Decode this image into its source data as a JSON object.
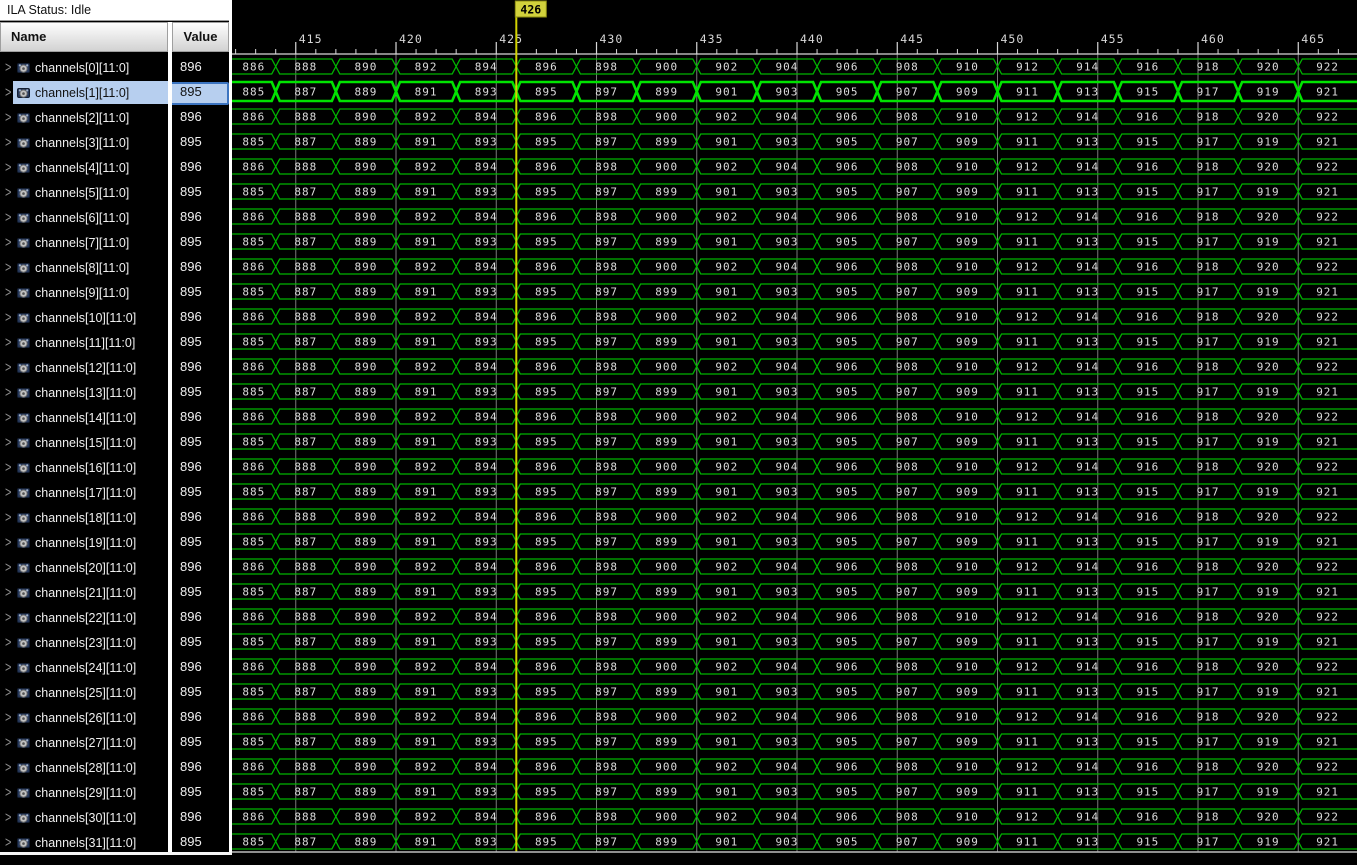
{
  "status_bar": {
    "text": "ILA Status: Idle"
  },
  "signal_table": {
    "columns": [
      "Name",
      "Value"
    ],
    "selected_index": 1,
    "rows": [
      {
        "name": "channels[0][11:0]",
        "value": "896"
      },
      {
        "name": "channels[1][11:0]",
        "value": "895"
      },
      {
        "name": "channels[2][11:0]",
        "value": "896"
      },
      {
        "name": "channels[3][11:0]",
        "value": "895"
      },
      {
        "name": "channels[4][11:0]",
        "value": "896"
      },
      {
        "name": "channels[5][11:0]",
        "value": "895"
      },
      {
        "name": "channels[6][11:0]",
        "value": "896"
      },
      {
        "name": "channels[7][11:0]",
        "value": "895"
      },
      {
        "name": "channels[8][11:0]",
        "value": "896"
      },
      {
        "name": "channels[9][11:0]",
        "value": "895"
      },
      {
        "name": "channels[10][11:0]",
        "value": "896"
      },
      {
        "name": "channels[11][11:0]",
        "value": "895"
      },
      {
        "name": "channels[12][11:0]",
        "value": "896"
      },
      {
        "name": "channels[13][11:0]",
        "value": "895"
      },
      {
        "name": "channels[14][11:0]",
        "value": "896"
      },
      {
        "name": "channels[15][11:0]",
        "value": "895"
      },
      {
        "name": "channels[16][11:0]",
        "value": "896"
      },
      {
        "name": "channels[17][11:0]",
        "value": "895"
      },
      {
        "name": "channels[18][11:0]",
        "value": "896"
      },
      {
        "name": "channels[19][11:0]",
        "value": "895"
      },
      {
        "name": "channels[20][11:0]",
        "value": "896"
      },
      {
        "name": "channels[21][11:0]",
        "value": "895"
      },
      {
        "name": "channels[22][11:0]",
        "value": "896"
      },
      {
        "name": "channels[23][11:0]",
        "value": "895"
      },
      {
        "name": "channels[24][11:0]",
        "value": "896"
      },
      {
        "name": "channels[25][11:0]",
        "value": "895"
      },
      {
        "name": "channels[26][11:0]",
        "value": "896"
      },
      {
        "name": "channels[27][11:0]",
        "value": "895"
      },
      {
        "name": "channels[28][11:0]",
        "value": "896"
      },
      {
        "name": "channels[29][11:0]",
        "value": "895"
      },
      {
        "name": "channels[30][11:0]",
        "value": "896"
      },
      {
        "name": "channels[31][11:0]",
        "value": "895"
      }
    ]
  },
  "chart_data": {
    "type": "waveform",
    "time_axis": {
      "view_start": 411.82,
      "view_end": 467.93,
      "major_tick_step": 5,
      "minor_tick_step": 1,
      "major_tick_labels": [
        "415",
        "420",
        "425",
        "430",
        "435",
        "440",
        "445",
        "450",
        "455",
        "460",
        "465"
      ],
      "grid": "major-vertical"
    },
    "cursor": {
      "time": 426,
      "label": "426"
    },
    "bus": {
      "first_transition_time": 414,
      "transition_step": 3,
      "even_row_values": [
        886,
        888,
        890,
        892,
        894,
        896,
        898,
        900,
        902,
        904,
        906,
        908,
        910,
        912,
        914,
        916,
        918,
        920,
        922
      ],
      "odd_row_values": [
        885,
        887,
        889,
        891,
        893,
        895,
        897,
        899,
        901,
        903,
        905,
        907,
        909,
        911,
        913,
        915,
        917,
        919,
        921
      ],
      "row_value_pattern": "even rows of channels use even_row_values, odd rows use odd_row_values"
    },
    "colors": {
      "wave_green": "#00b400",
      "wave_green_selected": "#00e400",
      "grid_gray": "#7a7a7a",
      "ruler_white": "#d8d8d8",
      "cursor_yellow": "#d2d200",
      "cursor_flag_bg": "#d2d23c",
      "value_text": "#dcdcdc",
      "selection_blue_bg": "#b7cfef",
      "selection_blue_border": "#3c74c0"
    }
  }
}
